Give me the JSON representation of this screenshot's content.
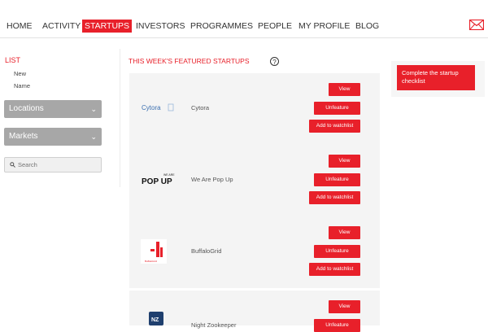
{
  "nav": {
    "items": [
      {
        "label": "HOME"
      },
      {
        "label": "ACTIVITY"
      },
      {
        "label": "STARTUPS"
      },
      {
        "label": "INVESTORS"
      },
      {
        "label": "PROGRAMMES"
      },
      {
        "label": "PEOPLE"
      },
      {
        "label": "MY PROFILE"
      },
      {
        "label": "BLOG"
      }
    ],
    "active": "STARTUPS",
    "mail_icon": "mail-icon"
  },
  "sidebar": {
    "list_title": "LIST",
    "sort_options": [
      "New",
      "Name"
    ],
    "filters": [
      {
        "label": "Locations"
      },
      {
        "label": "Markets"
      }
    ],
    "search": {
      "placeholder": "Search",
      "value": ""
    }
  },
  "main": {
    "featured_title": "THIS WEEK'S FEATURED STARTUPS",
    "help_glyph": "?",
    "startups": [
      {
        "name": "Cytora",
        "logo_text": "Cytora"
      },
      {
        "name": "We Are Pop Up",
        "logo_text": "POP UP",
        "logo_small_text": "WE ARE"
      },
      {
        "name": "BuffaloGrid",
        "logo_text": "BuffaloGrid"
      },
      {
        "name": "Night Zookeeper",
        "logo_text": "NZ"
      }
    ],
    "buttons": {
      "view": "View",
      "unfeature": "Unfeature",
      "watchlist": "Add to watchlist"
    }
  },
  "right": {
    "checklist_button": "Complete the startup checklist"
  },
  "colors": {
    "accent": "#e8202a",
    "filter_bg": "#a7a7a7",
    "card_bg": "#f4f4f4"
  }
}
